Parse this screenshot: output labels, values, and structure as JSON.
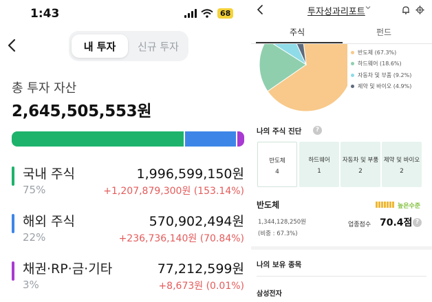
{
  "left": {
    "status": {
      "time": "1:43",
      "battery": "68"
    },
    "segment": {
      "active": "내 투자",
      "inactive": "신규 투자"
    },
    "total": {
      "label": "총 투자 자산",
      "value": "2,645,505,553원"
    },
    "allocation_bar": [
      {
        "key": "domestic",
        "share": 75,
        "color": "#1db36b"
      },
      {
        "key": "overseas",
        "share": 22,
        "color": "#3d86e8"
      },
      {
        "key": "other",
        "share": 3,
        "color": "#a93ad1"
      }
    ],
    "assets": [
      {
        "name": "국내 주식",
        "percent": "75%",
        "amount": "1,996,599,150원",
        "gain": "+1,207,879,300원 (153.14%)",
        "color": "#1db36b"
      },
      {
        "name": "해외 주식",
        "percent": "22%",
        "amount": "570,902,494원",
        "gain": "+236,736,140원 (70.84%)",
        "color": "#3d86e8"
      },
      {
        "name": "채권·RP·금·기타",
        "percent": "3%",
        "amount": "77,212,599원",
        "gain": "+8,673원 (0.01%)",
        "color": "#a93ad1"
      }
    ]
  },
  "right": {
    "title": "투자성과리포트",
    "tabs": [
      "주식",
      "펀드"
    ],
    "legend": [
      {
        "label": "반도체 (67.3%)",
        "share": 67.3,
        "color": "#f8c98a"
      },
      {
        "label": "하드웨어 (18.6%)",
        "share": 18.6,
        "color": "#8fcfae"
      },
      {
        "label": "자동차 및 부품 (9.2%)",
        "share": 9.2,
        "color": "#8fdbe8"
      },
      {
        "label": "제약 및 바이오 (4.9%)",
        "share": 4.9,
        "color": "#5d6b7d"
      }
    ],
    "diagnosis": {
      "heading": "나의 주식 진단",
      "help": "?",
      "tiles": [
        {
          "name": "반도체",
          "count": "4"
        },
        {
          "name": "하드웨어",
          "count": "1"
        },
        {
          "name": "자동차 및 부품",
          "count": "2"
        },
        {
          "name": "제약 및 바이오",
          "count": "2"
        }
      ]
    },
    "selected": {
      "name": "반도체",
      "amount": "1,344,128,250원",
      "ratio": "(비중 : 67.3%)",
      "level": "높은수준",
      "score_label": "업종점수",
      "score": "70.4점"
    },
    "holdings": {
      "heading": "나의 보유 종목",
      "first": "삼성전자"
    }
  }
}
